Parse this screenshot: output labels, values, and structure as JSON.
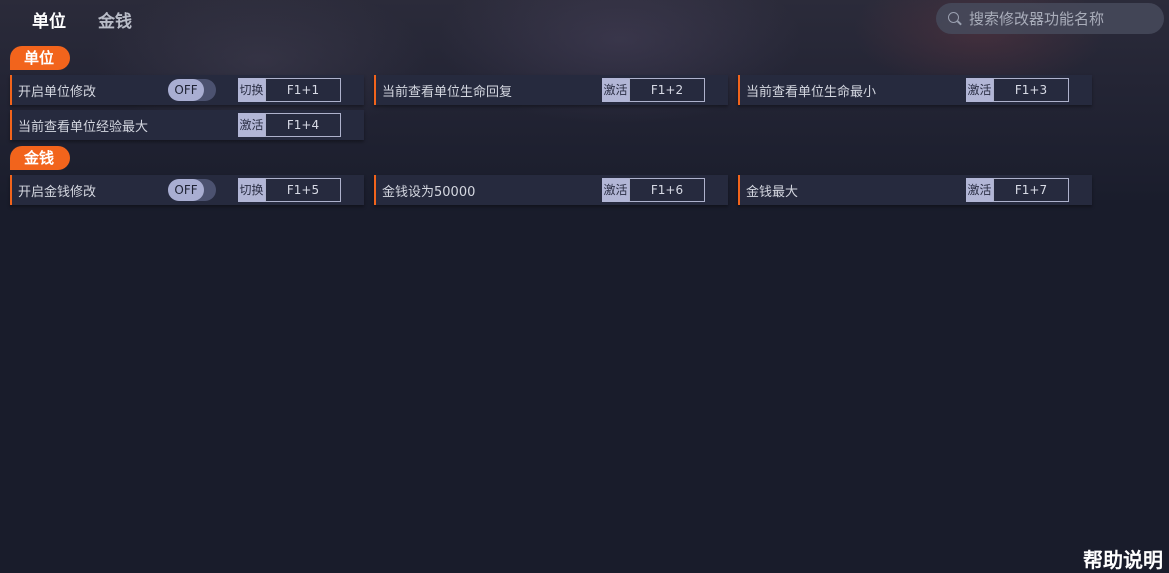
{
  "tabs": [
    {
      "label": "单位",
      "active": true
    },
    {
      "label": "金钱",
      "active": false
    }
  ],
  "search": {
    "placeholder": "搜索修改器功能名称",
    "value": ""
  },
  "accent_color": "#f2641c",
  "sections": [
    {
      "title": "单位",
      "items": [
        {
          "label": "开启单位修改",
          "toggle": "OFF",
          "action": "切换",
          "hotkey": "F1+1"
        },
        {
          "label": "当前查看单位生命回复",
          "action": "激活",
          "hotkey": "F1+2"
        },
        {
          "label": "当前查看单位生命最小",
          "action": "激活",
          "hotkey": "F1+3"
        },
        {
          "label": "当前查看单位经验最大",
          "action": "激活",
          "hotkey": "F1+4"
        }
      ]
    },
    {
      "title": "金钱",
      "items": [
        {
          "label": "开启金钱修改",
          "toggle": "OFF",
          "action": "切换",
          "hotkey": "F1+5"
        },
        {
          "label": "金钱设为50000",
          "action": "激活",
          "hotkey": "F1+6"
        },
        {
          "label": "金钱最大",
          "action": "激活",
          "hotkey": "F1+7"
        }
      ]
    }
  ],
  "help_label": "帮助说明"
}
